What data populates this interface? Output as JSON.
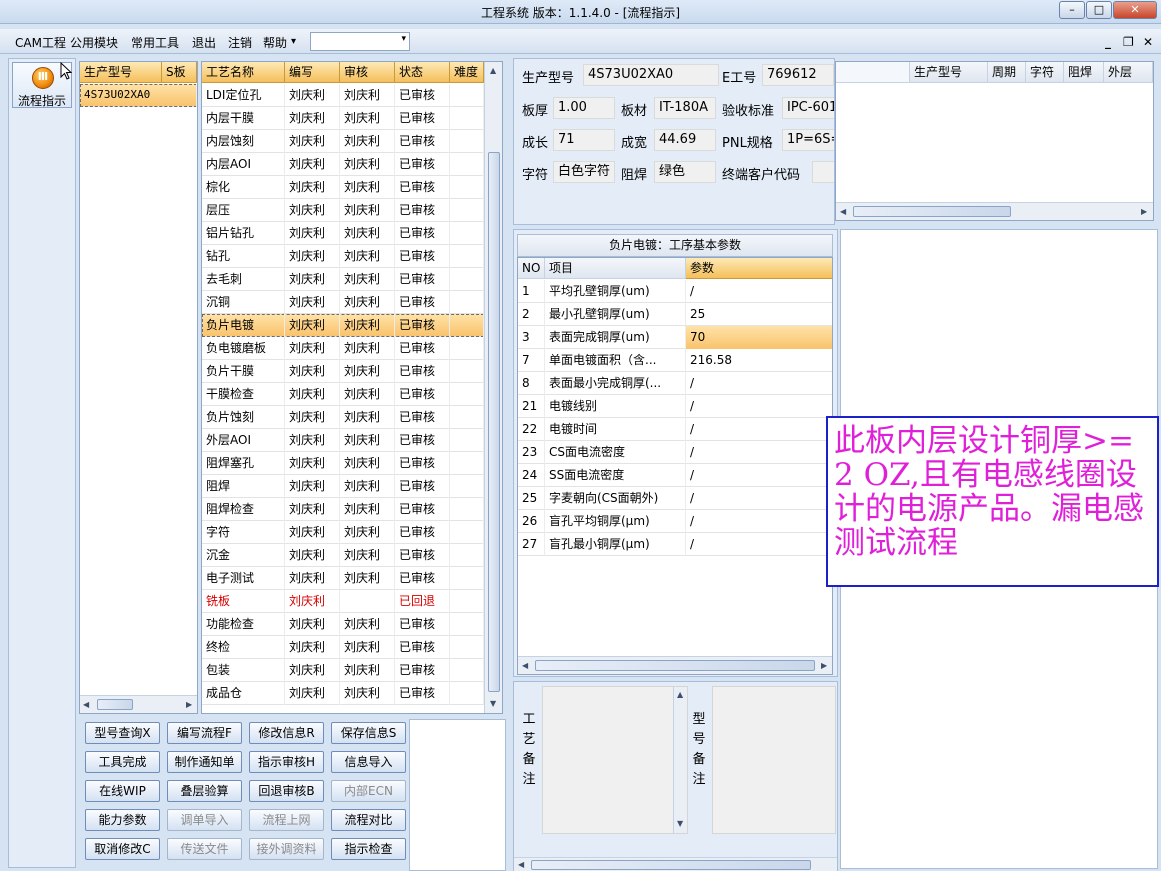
{
  "window": {
    "title": "工程系统  版本：1.1.4.0 - [流程指示]",
    "minimize": "–",
    "maximize": "□",
    "close": "✕"
  },
  "menu": {
    "items": [
      "CAM工程",
      "公用模块",
      "常用工具",
      "退出",
      "注销",
      "帮助"
    ],
    "help_arrow": "▾",
    "combo_value": "",
    "mdi_min": "_",
    "mdi_restore": "❐",
    "mdi_close": "✕"
  },
  "nav": {
    "flow_button": "流程指示",
    "icon": "flow-gauge-icon"
  },
  "models": {
    "headers": [
      "生产型号",
      "S板"
    ],
    "rows": [
      [
        "4S73U02XA0",
        ""
      ]
    ]
  },
  "process": {
    "headers": [
      "工艺名称",
      "编写",
      "审核",
      "状态",
      "难度"
    ],
    "rows": [
      [
        "LDI定位孔",
        "刘庆利",
        "刘庆利",
        "已审核",
        ""
      ],
      [
        "内层干膜",
        "刘庆利",
        "刘庆利",
        "已审核",
        ""
      ],
      [
        "内层蚀刻",
        "刘庆利",
        "刘庆利",
        "已审核",
        ""
      ],
      [
        "内层AOI",
        "刘庆利",
        "刘庆利",
        "已审核",
        ""
      ],
      [
        "棕化",
        "刘庆利",
        "刘庆利",
        "已审核",
        ""
      ],
      [
        "层压",
        "刘庆利",
        "刘庆利",
        "已审核",
        ""
      ],
      [
        "铝片钻孔",
        "刘庆利",
        "刘庆利",
        "已审核",
        ""
      ],
      [
        "钻孔",
        "刘庆利",
        "刘庆利",
        "已审核",
        ""
      ],
      [
        "去毛刺",
        "刘庆利",
        "刘庆利",
        "已审核",
        ""
      ],
      [
        "沉铜",
        "刘庆利",
        "刘庆利",
        "已审核",
        ""
      ],
      [
        "负片电镀",
        "刘庆利",
        "刘庆利",
        "已审核",
        ""
      ],
      [
        "负电镀磨板",
        "刘庆利",
        "刘庆利",
        "已审核",
        ""
      ],
      [
        "负片干膜",
        "刘庆利",
        "刘庆利",
        "已审核",
        ""
      ],
      [
        "干膜检查",
        "刘庆利",
        "刘庆利",
        "已审核",
        ""
      ],
      [
        "负片蚀刻",
        "刘庆利",
        "刘庆利",
        "已审核",
        ""
      ],
      [
        "外层AOI",
        "刘庆利",
        "刘庆利",
        "已审核",
        ""
      ],
      [
        "阻焊塞孔",
        "刘庆利",
        "刘庆利",
        "已审核",
        ""
      ],
      [
        "阻焊",
        "刘庆利",
        "刘庆利",
        "已审核",
        ""
      ],
      [
        "阻焊检查",
        "刘庆利",
        "刘庆利",
        "已审核",
        ""
      ],
      [
        "字符",
        "刘庆利",
        "刘庆利",
        "已审核",
        ""
      ],
      [
        "沉金",
        "刘庆利",
        "刘庆利",
        "已审核",
        ""
      ],
      [
        "电子测试",
        "刘庆利",
        "刘庆利",
        "已审核",
        ""
      ],
      [
        "铣板",
        "刘庆利",
        "",
        "已回退",
        ""
      ],
      [
        "功能检查",
        "刘庆利",
        "刘庆利",
        "已审核",
        ""
      ],
      [
        "终检",
        "刘庆利",
        "刘庆利",
        "已审核",
        ""
      ],
      [
        "包装",
        "刘庆利",
        "刘庆利",
        "已审核",
        ""
      ],
      [
        "成品仓",
        "刘庆利",
        "刘庆利",
        "已审核",
        ""
      ]
    ],
    "selected_index": 10,
    "rejected_index": 22
  },
  "buttons": [
    {
      "label": "型号查询X",
      "enabled": true
    },
    {
      "label": "编写流程F",
      "enabled": true
    },
    {
      "label": "修改信息R",
      "enabled": true
    },
    {
      "label": "保存信息S",
      "enabled": true
    },
    {
      "label": "工具完成",
      "enabled": true
    },
    {
      "label": "制作通知单",
      "enabled": true
    },
    {
      "label": "指示审核H",
      "enabled": true
    },
    {
      "label": "信息导入",
      "enabled": true
    },
    {
      "label": "在线WIP",
      "enabled": true
    },
    {
      "label": "叠层验算",
      "enabled": true
    },
    {
      "label": "回退审核B",
      "enabled": true
    },
    {
      "label": "内部ECN",
      "enabled": false
    },
    {
      "label": "能力参数",
      "enabled": true
    },
    {
      "label": "调单导入",
      "enabled": false
    },
    {
      "label": "流程上网",
      "enabled": false
    },
    {
      "label": "流程对比",
      "enabled": true
    },
    {
      "label": "取消修改C",
      "enabled": true
    },
    {
      "label": "传送文件",
      "enabled": false
    },
    {
      "label": "接外调资料",
      "enabled": false
    },
    {
      "label": "指示检查",
      "enabled": true
    }
  ],
  "info": {
    "model_label": "生产型号",
    "model": "4S73U02XA0",
    "eno_label": "E工号",
    "eno": "769612",
    "thick_label": "板厚",
    "thick": "1.00",
    "material_label": "板材",
    "material": "IT-180A",
    "std_label": "验收标准",
    "std": "IPC-601",
    "len_label": "成长",
    "len": "71",
    "wid_label": "成宽",
    "wid": "44.69",
    "pnl_label": "PNL规格",
    "pnl": "1P=6S=",
    "char_label": "字符",
    "char": "白色字符",
    "mask_label": "阻焊",
    "mask": "绿色",
    "cust_label": "终端客户代码",
    "cust": ""
  },
  "side_grid": {
    "headers": [
      "生产型号",
      "周期",
      "字符",
      "阻焊",
      "外层"
    ]
  },
  "params": {
    "title": "负片电镀：工序基本参数",
    "headers": [
      "NO",
      "项目",
      "参数"
    ],
    "rows": [
      [
        "1",
        "平均孔壁铜厚(um)",
        "/"
      ],
      [
        "2",
        "最小孔壁铜厚(um)",
        "25"
      ],
      [
        "3",
        "表面完成铜厚(um)",
        "70"
      ],
      [
        "7",
        "单面电镀面积（含...",
        "216.58"
      ],
      [
        "8",
        "表面最小完成铜厚(...",
        "/"
      ],
      [
        "21",
        "电镀线别",
        "/"
      ],
      [
        "22",
        "电镀时间",
        "/"
      ],
      [
        "23",
        "CS面电流密度",
        "/"
      ],
      [
        "24",
        "SS面电流密度",
        "/"
      ],
      [
        "25",
        "字麦朝向(CS面朝外)",
        "/"
      ],
      [
        "26",
        "盲孔平均铜厚(μm)",
        "/"
      ],
      [
        "27",
        "盲孔最小铜厚(μm)",
        "/"
      ]
    ],
    "selected_index": 2
  },
  "note": "此板内层设计铜厚>=2 OZ,且有电感线圈设计的电源产品。漏电感测试流程",
  "remarks": {
    "process_label": [
      "工",
      "艺",
      "备",
      "注"
    ],
    "model_label": [
      "型",
      "号",
      "备",
      "注"
    ]
  },
  "colors": {
    "header_orange": "#f5bf5b",
    "selected_row": "#f9c36c",
    "rejected_text": "#d60000",
    "note_text": "#e020d8",
    "note_border": "#1b20c8"
  }
}
